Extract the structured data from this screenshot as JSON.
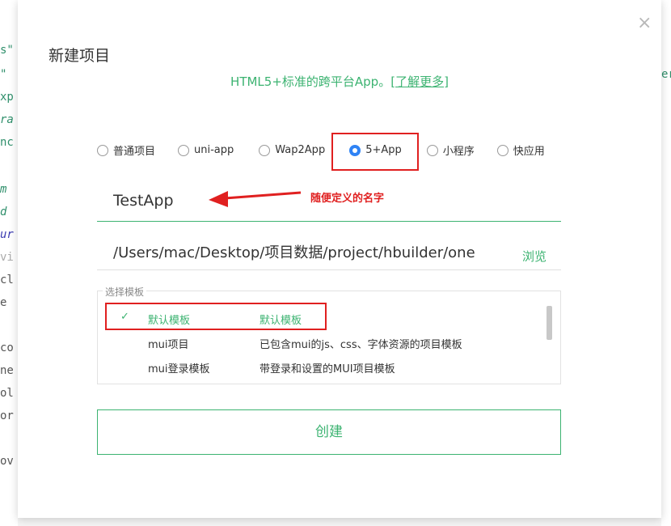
{
  "background": {
    "left_snippets": [
      "s\"",
      "\"",
      "xp",
      "ra",
      "nc",
      "m",
      "d",
      "ur",
      "vi",
      "cl",
      "e",
      "co",
      "ne",
      "ol",
      "or",
      "ov"
    ],
    "right_snippet": "er"
  },
  "dialog": {
    "title": "新建项目",
    "subtitle_text": "HTML5+标准的跨平台App。",
    "subtitle_link": "[了解更多]",
    "close_glyph": "×",
    "project_types": [
      {
        "label": "普通项目",
        "checked": false
      },
      {
        "label": "uni-app",
        "checked": false
      },
      {
        "label": "Wap2App",
        "checked": false
      },
      {
        "label": "5+App",
        "checked": true
      },
      {
        "label": "小程序",
        "checked": false
      },
      {
        "label": "快应用",
        "checked": false
      }
    ],
    "project_name": "TestApp",
    "annotation": "随便定义的名字",
    "location": "/Users/mac/Desktop/项目数据/project/hbuilder/one",
    "browse_label": "浏览",
    "template_section_label": "选择模板",
    "templates": [
      {
        "name": "默认模板",
        "desc": "默认模板",
        "selected": true
      },
      {
        "name": "mui项目",
        "desc": "已包含mui的js、css、字体资源的项目模板",
        "selected": false
      },
      {
        "name": "mui登录模板",
        "desc": "带登录和设置的MUI项目模板",
        "selected": false
      }
    ],
    "create_label": "创建",
    "check_glyph": "✓"
  },
  "colors": {
    "accent_green": "#3cb371",
    "annotation_red": "#e02020",
    "radio_blue": "#2f83f5"
  }
}
